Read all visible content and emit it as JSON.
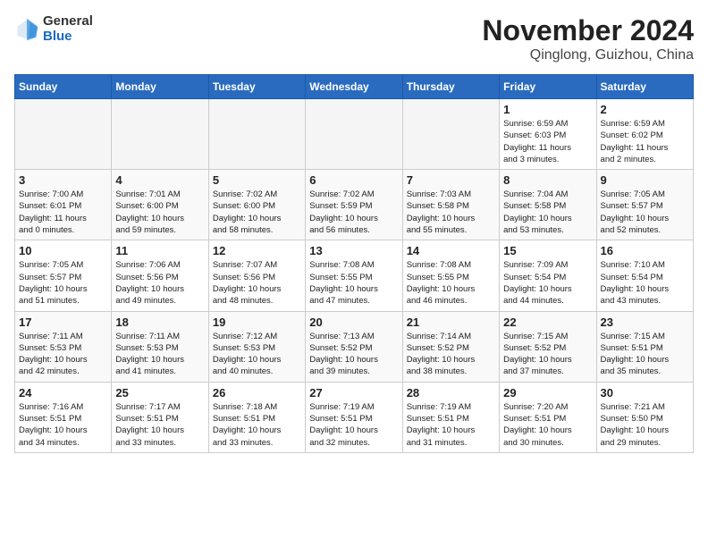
{
  "header": {
    "logo_general": "General",
    "logo_blue": "Blue",
    "month": "November 2024",
    "location": "Qinglong, Guizhou, China"
  },
  "weekdays": [
    "Sunday",
    "Monday",
    "Tuesday",
    "Wednesday",
    "Thursday",
    "Friday",
    "Saturday"
  ],
  "weeks": [
    [
      {
        "day": "",
        "info": ""
      },
      {
        "day": "",
        "info": ""
      },
      {
        "day": "",
        "info": ""
      },
      {
        "day": "",
        "info": ""
      },
      {
        "day": "",
        "info": ""
      },
      {
        "day": "1",
        "info": "Sunrise: 6:59 AM\nSunset: 6:03 PM\nDaylight: 11 hours\nand 3 minutes."
      },
      {
        "day": "2",
        "info": "Sunrise: 6:59 AM\nSunset: 6:02 PM\nDaylight: 11 hours\nand 2 minutes."
      }
    ],
    [
      {
        "day": "3",
        "info": "Sunrise: 7:00 AM\nSunset: 6:01 PM\nDaylight: 11 hours\nand 0 minutes."
      },
      {
        "day": "4",
        "info": "Sunrise: 7:01 AM\nSunset: 6:00 PM\nDaylight: 10 hours\nand 59 minutes."
      },
      {
        "day": "5",
        "info": "Sunrise: 7:02 AM\nSunset: 6:00 PM\nDaylight: 10 hours\nand 58 minutes."
      },
      {
        "day": "6",
        "info": "Sunrise: 7:02 AM\nSunset: 5:59 PM\nDaylight: 10 hours\nand 56 minutes."
      },
      {
        "day": "7",
        "info": "Sunrise: 7:03 AM\nSunset: 5:58 PM\nDaylight: 10 hours\nand 55 minutes."
      },
      {
        "day": "8",
        "info": "Sunrise: 7:04 AM\nSunset: 5:58 PM\nDaylight: 10 hours\nand 53 minutes."
      },
      {
        "day": "9",
        "info": "Sunrise: 7:05 AM\nSunset: 5:57 PM\nDaylight: 10 hours\nand 52 minutes."
      }
    ],
    [
      {
        "day": "10",
        "info": "Sunrise: 7:05 AM\nSunset: 5:57 PM\nDaylight: 10 hours\nand 51 minutes."
      },
      {
        "day": "11",
        "info": "Sunrise: 7:06 AM\nSunset: 5:56 PM\nDaylight: 10 hours\nand 49 minutes."
      },
      {
        "day": "12",
        "info": "Sunrise: 7:07 AM\nSunset: 5:56 PM\nDaylight: 10 hours\nand 48 minutes."
      },
      {
        "day": "13",
        "info": "Sunrise: 7:08 AM\nSunset: 5:55 PM\nDaylight: 10 hours\nand 47 minutes."
      },
      {
        "day": "14",
        "info": "Sunrise: 7:08 AM\nSunset: 5:55 PM\nDaylight: 10 hours\nand 46 minutes."
      },
      {
        "day": "15",
        "info": "Sunrise: 7:09 AM\nSunset: 5:54 PM\nDaylight: 10 hours\nand 44 minutes."
      },
      {
        "day": "16",
        "info": "Sunrise: 7:10 AM\nSunset: 5:54 PM\nDaylight: 10 hours\nand 43 minutes."
      }
    ],
    [
      {
        "day": "17",
        "info": "Sunrise: 7:11 AM\nSunset: 5:53 PM\nDaylight: 10 hours\nand 42 minutes."
      },
      {
        "day": "18",
        "info": "Sunrise: 7:11 AM\nSunset: 5:53 PM\nDaylight: 10 hours\nand 41 minutes."
      },
      {
        "day": "19",
        "info": "Sunrise: 7:12 AM\nSunset: 5:53 PM\nDaylight: 10 hours\nand 40 minutes."
      },
      {
        "day": "20",
        "info": "Sunrise: 7:13 AM\nSunset: 5:52 PM\nDaylight: 10 hours\nand 39 minutes."
      },
      {
        "day": "21",
        "info": "Sunrise: 7:14 AM\nSunset: 5:52 PM\nDaylight: 10 hours\nand 38 minutes."
      },
      {
        "day": "22",
        "info": "Sunrise: 7:15 AM\nSunset: 5:52 PM\nDaylight: 10 hours\nand 37 minutes."
      },
      {
        "day": "23",
        "info": "Sunrise: 7:15 AM\nSunset: 5:51 PM\nDaylight: 10 hours\nand 35 minutes."
      }
    ],
    [
      {
        "day": "24",
        "info": "Sunrise: 7:16 AM\nSunset: 5:51 PM\nDaylight: 10 hours\nand 34 minutes."
      },
      {
        "day": "25",
        "info": "Sunrise: 7:17 AM\nSunset: 5:51 PM\nDaylight: 10 hours\nand 33 minutes."
      },
      {
        "day": "26",
        "info": "Sunrise: 7:18 AM\nSunset: 5:51 PM\nDaylight: 10 hours\nand 33 minutes."
      },
      {
        "day": "27",
        "info": "Sunrise: 7:19 AM\nSunset: 5:51 PM\nDaylight: 10 hours\nand 32 minutes."
      },
      {
        "day": "28",
        "info": "Sunrise: 7:19 AM\nSunset: 5:51 PM\nDaylight: 10 hours\nand 31 minutes."
      },
      {
        "day": "29",
        "info": "Sunrise: 7:20 AM\nSunset: 5:51 PM\nDaylight: 10 hours\nand 30 minutes."
      },
      {
        "day": "30",
        "info": "Sunrise: 7:21 AM\nSunset: 5:50 PM\nDaylight: 10 hours\nand 29 minutes."
      }
    ]
  ]
}
